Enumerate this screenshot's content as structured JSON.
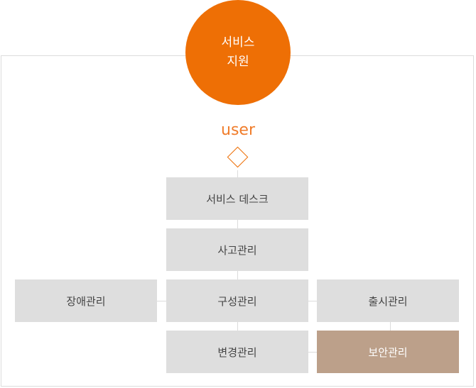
{
  "hub": {
    "line1": "서비스",
    "line2": "지원"
  },
  "user_label": "user",
  "nodes": {
    "service_desk": "서비스 데스크",
    "incident": "사고관리",
    "problem": "장애관리",
    "configuration": "구성관리",
    "release": "출시관리",
    "change": "변경관리",
    "security": "보안관리"
  },
  "colors": {
    "accent": "#ee6f05",
    "user_text": "#f07c2a",
    "box": "#dedede",
    "highlight_box": "#bca08a",
    "connector": "#dcdcdc"
  }
}
